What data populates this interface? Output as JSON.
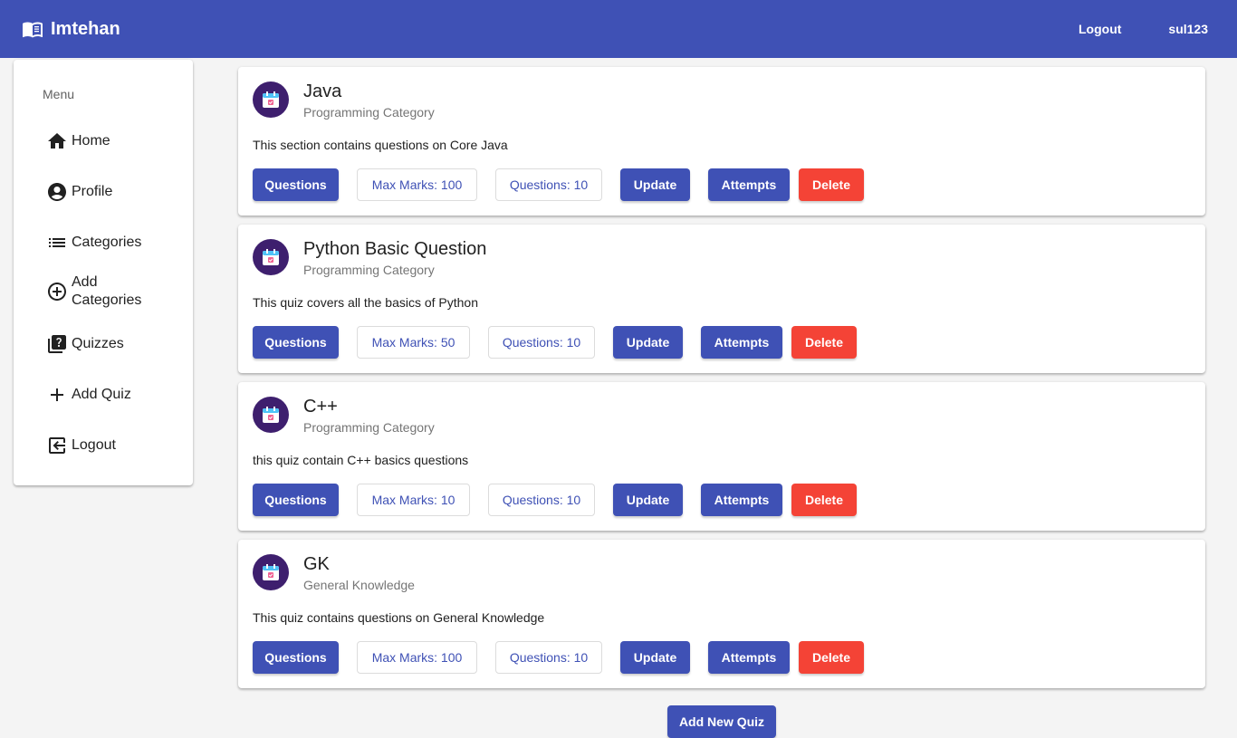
{
  "app": {
    "title": "Imtehan",
    "logout_label": "Logout",
    "username": "sul123",
    "brand_color": "#3f51b5"
  },
  "sidebar": {
    "header": "Menu",
    "items": [
      {
        "label": "Home",
        "icon": "home-icon"
      },
      {
        "label": "Profile",
        "icon": "account-circle-icon"
      },
      {
        "label": "Categories",
        "icon": "list-icon"
      },
      {
        "label": "Add Categories",
        "icon": "add-circle-icon"
      },
      {
        "label": "Quizzes",
        "icon": "quiz-icon"
      },
      {
        "label": "Add Quiz",
        "icon": "plus-icon"
      },
      {
        "label": "Logout",
        "icon": "logout-icon"
      }
    ]
  },
  "quizzes": [
    {
      "title": "Java",
      "category": "Programming Category",
      "description": "This section contains questions on Core Java",
      "questions_button": "Questions",
      "max_marks": "Max Marks: 100",
      "num_questions": "Questions: 10",
      "update_button": "Update",
      "attempts_button": "Attempts",
      "delete_button": "Delete"
    },
    {
      "title": "Python Basic Question",
      "category": "Programming Category",
      "description": "This quiz covers all the basics of Python",
      "questions_button": "Questions",
      "max_marks": "Max Marks: 50",
      "num_questions": "Questions: 10",
      "update_button": "Update",
      "attempts_button": "Attempts",
      "delete_button": "Delete"
    },
    {
      "title": "C++",
      "category": "Programming Category",
      "description": "this quiz contain C++ basics questions",
      "questions_button": "Questions",
      "max_marks": "Max Marks: 10",
      "num_questions": "Questions: 10",
      "update_button": "Update",
      "attempts_button": "Attempts",
      "delete_button": "Delete"
    },
    {
      "title": "GK",
      "category": "General Knowledge",
      "description": "This quiz contains questions on General Knowledge",
      "questions_button": "Questions",
      "max_marks": "Max Marks: 100",
      "num_questions": "Questions: 10",
      "update_button": "Update",
      "attempts_button": "Attempts",
      "delete_button": "Delete"
    }
  ],
  "add_new_quiz_button": "Add New Quiz",
  "colors": {
    "primary": "#3f51b5",
    "danger": "#f44336",
    "avatar_bg": "#3e1f6e"
  }
}
